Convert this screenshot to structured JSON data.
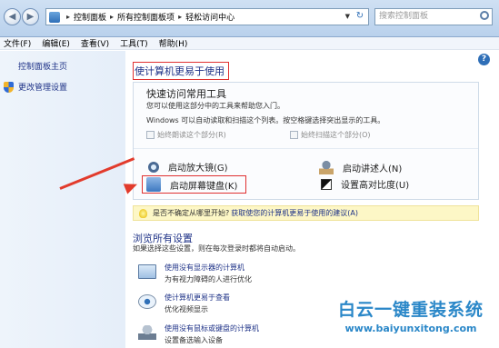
{
  "addressbar": {
    "crumbs": [
      "控制面板",
      "所有控制面板项",
      "轻松访问中心"
    ],
    "search_placeholder": "搜索控制面板"
  },
  "menu": [
    "文件(F)",
    "编辑(E)",
    "查看(V)",
    "工具(T)",
    "帮助(H)"
  ],
  "sidebar": {
    "home": "控制面板主页",
    "items": [
      {
        "label": "更改管理设置",
        "icon": "shield-icon"
      }
    ]
  },
  "main": {
    "heading": "使计算机更易于使用",
    "quick": {
      "title": "快速访问常用工具",
      "line1": "您可以使用这部分中的工具来帮助您入门。",
      "line2": "Windows 可以自动读取和扫描这个列表。按空格键选择突出显示的工具。",
      "check_read": "始终朗读这个部分(R)",
      "check_scan": "始终扫描这个部分(O)",
      "tools": [
        {
          "label": "启动放大镜(G)",
          "icon": "magnifier-icon"
        },
        {
          "label": "启动屏幕键盘(K)",
          "icon": "keyboard-icon"
        },
        {
          "label": "启动讲述人(N)",
          "icon": "narrator-icon"
        },
        {
          "label": "设置高对比度(U)",
          "icon": "contrast-icon"
        }
      ]
    },
    "tip": {
      "text": "是否不确定从哪里开始?",
      "link": "获取使您的计算机更易于使用的建议(A)"
    },
    "browse": {
      "title": "浏览所有设置",
      "desc": "如果选择这些设置，则在每次登录时都将自动启动。",
      "options": [
        {
          "link": "使用没有显示器的计算机",
          "desc": "为有视力障碍的人进行优化",
          "icon": "monitor-icon"
        },
        {
          "link": "使计算机更易于查看",
          "desc": "优化视频显示",
          "icon": "eye-icon"
        },
        {
          "link": "使用没有鼠标或键盘的计算机",
          "desc": "设置备选输入设备",
          "icon": "mouse-icon"
        }
      ]
    }
  },
  "watermark": {
    "name": "白云一键重装系统",
    "url": "www.baiyunxitong.com"
  },
  "colors": {
    "link": "#1e3287",
    "annotation_red": "#e03030",
    "watermark_blue": "#2a87c8"
  }
}
